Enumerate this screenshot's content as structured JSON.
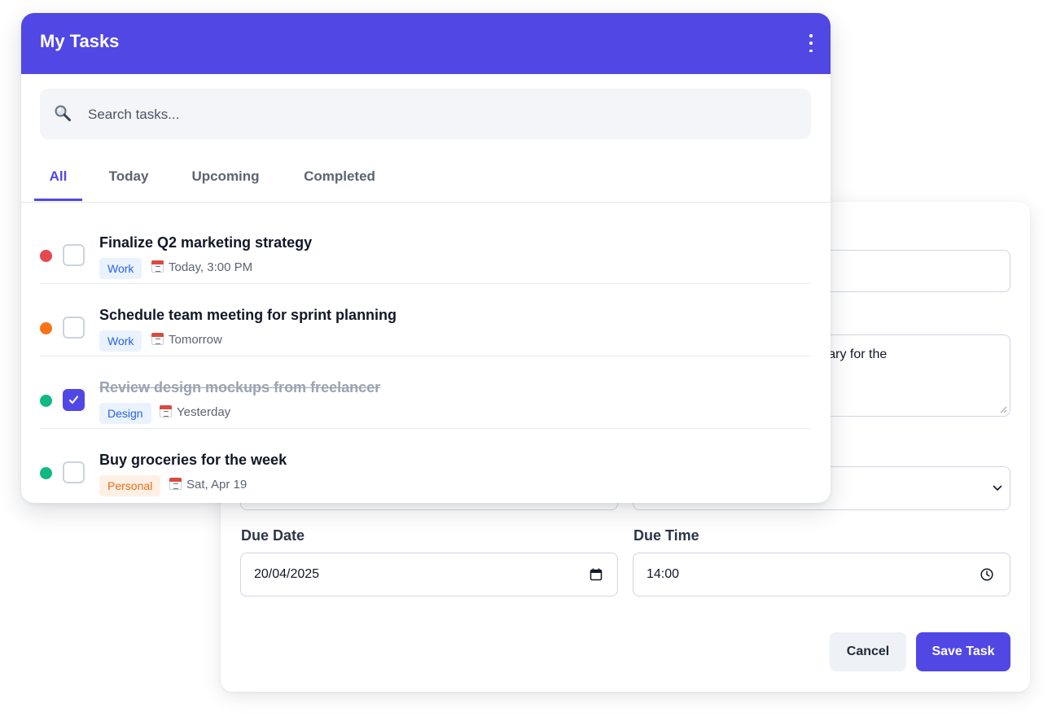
{
  "task_form": {
    "description_visible_text": "nmary for the",
    "due_date_label": "Due Date",
    "due_date_value": "20/04/2025",
    "due_time_label": "Due Time",
    "due_time_value": "14:00",
    "cancel_label": "Cancel",
    "save_label": "Save Task"
  },
  "tasks_panel": {
    "title": "My Tasks",
    "search_placeholder": "Search tasks...",
    "tabs": [
      {
        "label": "All",
        "active": true
      },
      {
        "label": "Today",
        "active": false
      },
      {
        "label": "Upcoming",
        "active": false
      },
      {
        "label": "Completed",
        "active": false
      }
    ],
    "tasks": [
      {
        "title": "Finalize Q2 marketing strategy",
        "priority_color": "#e5484d",
        "checked": false,
        "tag": "Work",
        "tag_color": "blue",
        "due": "Today, 3:00 PM"
      },
      {
        "title": "Schedule team meeting for sprint planning",
        "priority_color": "#f97316",
        "checked": false,
        "tag": "Work",
        "tag_color": "blue",
        "due": "Tomorrow"
      },
      {
        "title": "Review design mockups from freelancer",
        "priority_color": "#10b981",
        "checked": true,
        "tag": "Design",
        "tag_color": "blue",
        "due": "Yesterday"
      },
      {
        "title": "Buy groceries for the week",
        "priority_color": "#10b981",
        "checked": false,
        "tag": "Personal",
        "tag_color": "orange",
        "due": "Sat, Apr 19"
      }
    ]
  },
  "colors": {
    "accent": "#5147e5",
    "priority_high": "#e5484d",
    "priority_medium": "#f97316",
    "priority_low": "#10b981"
  },
  "icons": [
    "more-vertical-icon",
    "search-icon",
    "calendar-icon",
    "check-icon",
    "chevron-down-icon",
    "calendar-picker-icon",
    "clock-icon"
  ]
}
